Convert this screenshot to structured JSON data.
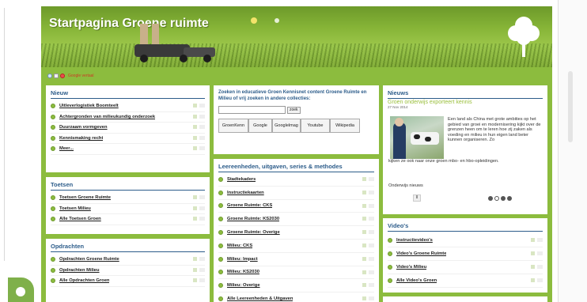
{
  "banner": {
    "title": "Startpagina Groene ruimte"
  },
  "iconbar": {
    "lang_label": "Google vertaal"
  },
  "nieuw": {
    "heading": "Nieuw",
    "items": [
      "Uitleverlogistiek Boomteelt",
      "Achtergronden van milieukundig onderzoek",
      "Duurzaam vormgeven",
      "Kennismaking recht",
      "Meer..."
    ]
  },
  "toetsen": {
    "heading": "Toetsen",
    "items": [
      "Toetsen Groene Ruimte",
      "Toetsen Milieu",
      "Alle Toetsen Groen"
    ]
  },
  "opdrachten": {
    "heading": "Opdrachten",
    "items": [
      "Opdrachten Groene Ruimte",
      "Opdrachten Milieu",
      "Alle Opdrachten Groen"
    ]
  },
  "search": {
    "text": "Zoeken in educatieve Groen Kennisnet content Groene Ruimte en Milieu of vrij zoeken in andere collecties:",
    "button": "zoek",
    "engines": [
      "GroenKenn",
      "Google",
      "Googlelmag",
      "Youtube",
      "Wikipedia"
    ]
  },
  "leereenheden": {
    "heading": "Leereenheden, uitgaven, series & methodes",
    "items": [
      "Stadtekaders",
      "Instructiekaarten",
      "Groene Ruimte: CKS",
      "Groene Ruimte: KS2030",
      "Groene Ruimte: Overige",
      "Milieu: CKS",
      "Milieu: Impact",
      "Milieu: KS2030",
      "Milieu: Overige",
      "Alle Leereenheden & Uitgaven"
    ]
  },
  "nieuws": {
    "heading": "Nieuws",
    "title": "Groen onderwijs exporteert kennis",
    "date": "27 Nov 2014",
    "body": "Een land als China met grote ambities op het gebied van groei en modernisering kijkt over de grenzen heen om te leren hoe zij zaken als voeding en milieu in hun eigen land beter kunnen organiseren. Zo",
    "body2": "kijken ze ook naar onze groen mbo- en hbo-opleidingen.",
    "more": "Onderwijs nieuws",
    "pause": "II"
  },
  "videos": {
    "heading": "Video's",
    "items": [
      "Instructievideo's",
      "Video's Groene Ruimte",
      "Video's Milieu",
      "Alle Video's Groen"
    ]
  }
}
